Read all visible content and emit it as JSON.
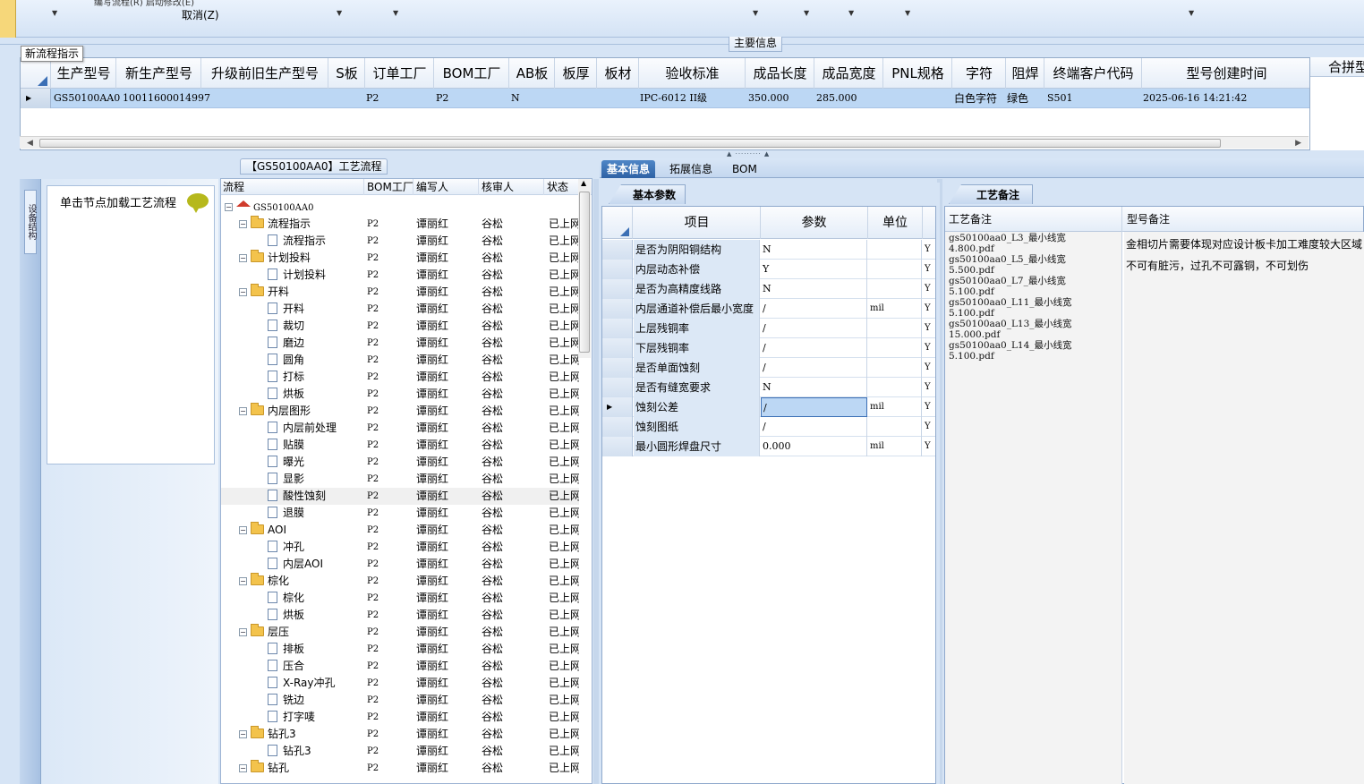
{
  "toolbar": {
    "hint_top": "编写流程(R)    启动修改(E)",
    "cancel_label": "取消(Z)"
  },
  "new_flow_indicator": "新流程指示",
  "main_info_title": "主要信息",
  "main_grid": {
    "columns": [
      "生产型号",
      "新生产型号",
      "升级前旧生产型号",
      "S板",
      "订单工厂",
      "BOM工厂",
      "AB板",
      "板厚",
      "板材",
      "验收标准",
      "成品长度",
      "成品宽度",
      "PNL规格",
      "字符",
      "阻焊",
      "终端客户代码",
      "型号创建时间"
    ],
    "row": [
      "GS50100AA0",
      "10011600014997",
      "",
      "",
      "P2",
      "P2",
      "N",
      "",
      "",
      "IPC-6012 II级",
      "350.000",
      "285.000",
      "",
      "白色字符",
      "绿色",
      "S501",
      "2025-06-16 14:21:42"
    ],
    "right_header": "合拼型"
  },
  "left_panel": {
    "vertical_tab": "设备结构",
    "load_hint": "单击节点加载工艺流程"
  },
  "tree": {
    "title": "【GS50100AA0】工艺流程",
    "columns": [
      "流程",
      "BOM工厂",
      "编写人",
      "核审人",
      "状态"
    ],
    "root": "GS50100AA0",
    "rows": [
      {
        "name": "流程指示",
        "level": 1,
        "folder": true,
        "plant": "P2",
        "writer": "谭丽红",
        "reviewer": "谷松",
        "status": "已上网"
      },
      {
        "name": "流程指示",
        "level": 2,
        "folder": false,
        "plant": "P2",
        "writer": "谭丽红",
        "reviewer": "谷松",
        "status": "已上网"
      },
      {
        "name": "计划投料",
        "level": 1,
        "folder": true,
        "plant": "P2",
        "writer": "谭丽红",
        "reviewer": "谷松",
        "status": "已上网"
      },
      {
        "name": "计划投料",
        "level": 2,
        "folder": false,
        "plant": "P2",
        "writer": "谭丽红",
        "reviewer": "谷松",
        "status": "已上网"
      },
      {
        "name": "开料",
        "level": 1,
        "folder": true,
        "plant": "P2",
        "writer": "谭丽红",
        "reviewer": "谷松",
        "status": "已上网"
      },
      {
        "name": "开料",
        "level": 2,
        "folder": false,
        "plant": "P2",
        "writer": "谭丽红",
        "reviewer": "谷松",
        "status": "已上网"
      },
      {
        "name": "裁切",
        "level": 2,
        "folder": false,
        "plant": "P2",
        "writer": "谭丽红",
        "reviewer": "谷松",
        "status": "已上网"
      },
      {
        "name": "磨边",
        "level": 2,
        "folder": false,
        "plant": "P2",
        "writer": "谭丽红",
        "reviewer": "谷松",
        "status": "已上网"
      },
      {
        "name": "圆角",
        "level": 2,
        "folder": false,
        "plant": "P2",
        "writer": "谭丽红",
        "reviewer": "谷松",
        "status": "已上网"
      },
      {
        "name": "打标",
        "level": 2,
        "folder": false,
        "plant": "P2",
        "writer": "谭丽红",
        "reviewer": "谷松",
        "status": "已上网"
      },
      {
        "name": "烘板",
        "level": 2,
        "folder": false,
        "plant": "P2",
        "writer": "谭丽红",
        "reviewer": "谷松",
        "status": "已上网"
      },
      {
        "name": "内层图形",
        "level": 1,
        "folder": true,
        "plant": "P2",
        "writer": "谭丽红",
        "reviewer": "谷松",
        "status": "已上网"
      },
      {
        "name": "内层前处理",
        "level": 2,
        "folder": false,
        "plant": "P2",
        "writer": "谭丽红",
        "reviewer": "谷松",
        "status": "已上网"
      },
      {
        "name": "贴膜",
        "level": 2,
        "folder": false,
        "plant": "P2",
        "writer": "谭丽红",
        "reviewer": "谷松",
        "status": "已上网"
      },
      {
        "name": "曝光",
        "level": 2,
        "folder": false,
        "plant": "P2",
        "writer": "谭丽红",
        "reviewer": "谷松",
        "status": "已上网"
      },
      {
        "name": "显影",
        "level": 2,
        "folder": false,
        "plant": "P2",
        "writer": "谭丽红",
        "reviewer": "谷松",
        "status": "已上网"
      },
      {
        "name": "酸性蚀刻",
        "level": 2,
        "folder": false,
        "plant": "P2",
        "writer": "谭丽红",
        "reviewer": "谷松",
        "status": "已上网",
        "selected": true
      },
      {
        "name": "退膜",
        "level": 2,
        "folder": false,
        "plant": "P2",
        "writer": "谭丽红",
        "reviewer": "谷松",
        "status": "已上网"
      },
      {
        "name": "AOI",
        "level": 1,
        "folder": true,
        "plant": "P2",
        "writer": "谭丽红",
        "reviewer": "谷松",
        "status": "已上网"
      },
      {
        "name": "冲孔",
        "level": 2,
        "folder": false,
        "plant": "P2",
        "writer": "谭丽红",
        "reviewer": "谷松",
        "status": "已上网"
      },
      {
        "name": "内层AOI",
        "level": 2,
        "folder": false,
        "plant": "P2",
        "writer": "谭丽红",
        "reviewer": "谷松",
        "status": "已上网"
      },
      {
        "name": "棕化",
        "level": 1,
        "folder": true,
        "plant": "P2",
        "writer": "谭丽红",
        "reviewer": "谷松",
        "status": "已上网"
      },
      {
        "name": "棕化",
        "level": 2,
        "folder": false,
        "plant": "P2",
        "writer": "谭丽红",
        "reviewer": "谷松",
        "status": "已上网"
      },
      {
        "name": "烘板",
        "level": 2,
        "folder": false,
        "plant": "P2",
        "writer": "谭丽红",
        "reviewer": "谷松",
        "status": "已上网"
      },
      {
        "name": "层压",
        "level": 1,
        "folder": true,
        "plant": "P2",
        "writer": "谭丽红",
        "reviewer": "谷松",
        "status": "已上网"
      },
      {
        "name": "排板",
        "level": 2,
        "folder": false,
        "plant": "P2",
        "writer": "谭丽红",
        "reviewer": "谷松",
        "status": "已上网"
      },
      {
        "name": "压合",
        "level": 2,
        "folder": false,
        "plant": "P2",
        "writer": "谭丽红",
        "reviewer": "谷松",
        "status": "已上网"
      },
      {
        "name": "X-Ray冲孔",
        "level": 2,
        "folder": false,
        "plant": "P2",
        "writer": "谭丽红",
        "reviewer": "谷松",
        "status": "已上网"
      },
      {
        "name": "铣边",
        "level": 2,
        "folder": false,
        "plant": "P2",
        "writer": "谭丽红",
        "reviewer": "谷松",
        "status": "已上网"
      },
      {
        "name": "打字唛",
        "level": 2,
        "folder": false,
        "plant": "P2",
        "writer": "谭丽红",
        "reviewer": "谷松",
        "status": "已上网"
      },
      {
        "name": "钻孔3",
        "level": 1,
        "folder": true,
        "plant": "P2",
        "writer": "谭丽红",
        "reviewer": "谷松",
        "status": "已上网"
      },
      {
        "name": "钻孔3",
        "level": 2,
        "folder": false,
        "plant": "P2",
        "writer": "谭丽红",
        "reviewer": "谷松",
        "status": "已上网"
      },
      {
        "name": "钻孔",
        "level": 1,
        "folder": true,
        "plant": "P2",
        "writer": "谭丽红",
        "reviewer": "谷松",
        "status": "已上网"
      }
    ]
  },
  "tabs": [
    "基本信息",
    "拓展信息",
    "BOM"
  ],
  "basic_params": {
    "title": "基本参数",
    "columns": [
      "项目",
      "参数",
      "单位"
    ],
    "rows": [
      {
        "item": "是否为阴阳铜结构",
        "param": "N",
        "unit": "",
        "flag": "Y"
      },
      {
        "item": "内层动态补偿",
        "param": "Y",
        "unit": "",
        "flag": "Y"
      },
      {
        "item": "是否为高精度线路",
        "param": "N",
        "unit": "",
        "flag": "Y"
      },
      {
        "item": "内层通道补偿后最小宽度",
        "param": "/",
        "unit": "mil",
        "flag": "Y"
      },
      {
        "item": "上层残铜率",
        "param": "/",
        "unit": "",
        "flag": "Y"
      },
      {
        "item": "下层残铜率",
        "param": "/",
        "unit": "",
        "flag": "Y"
      },
      {
        "item": "是否单面蚀刻",
        "param": "/",
        "unit": "",
        "flag": "Y"
      },
      {
        "item": "是否有缝宽要求",
        "param": "N",
        "unit": "",
        "flag": "Y"
      },
      {
        "item": "蚀刻公差",
        "param": "/",
        "unit": "mil",
        "flag": "Y",
        "selected": true
      },
      {
        "item": "蚀刻图纸",
        "param": "/",
        "unit": "",
        "flag": "Y"
      },
      {
        "item": "最小圆形焊盘尺寸",
        "param": "0.000",
        "unit": "mil",
        "flag": "Y"
      }
    ]
  },
  "remarks": {
    "title": "工艺备注",
    "columns": [
      "工艺备注",
      "型号备注"
    ],
    "files": "gs50100aa0_L3_最小线宽\n4.800.pdf\ngs50100aa0_L5_最小线宽\n5.500.pdf\ngs50100aa0_L7_最小线宽\n5.100.pdf\ngs50100aa0_L11_最小线宽\n5.100.pdf\ngs50100aa0_L13_最小线宽\n15.000.pdf\ngs50100aa0_L14_最小线宽\n5.100.pdf",
    "model_lines": [
      "金相切片需要体现对应设计板卡加工难度较大区域",
      "不可有脏污，过孔不可露铜，不可划伤"
    ]
  },
  "colors": {
    "accent": "#2e62a5",
    "selection": "#bcd7f4",
    "background": "#d6e4f5"
  }
}
